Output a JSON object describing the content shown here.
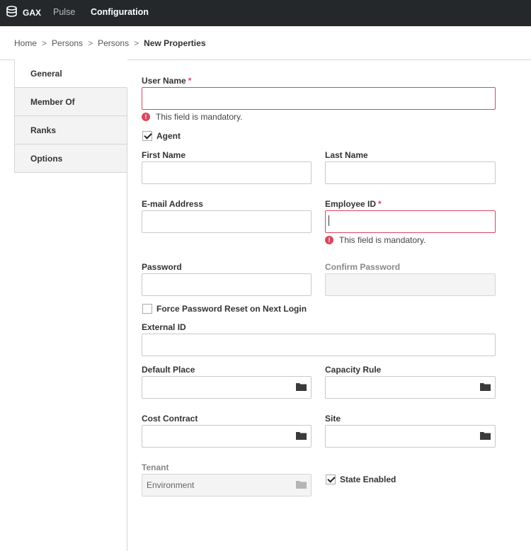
{
  "topbar": {
    "brand": "GAX",
    "nav": {
      "pulse": "Pulse",
      "configuration": "Configuration"
    }
  },
  "breadcrumb": {
    "items": [
      "Home",
      "Persons",
      "Persons"
    ],
    "current": "New Properties",
    "separator": ">"
  },
  "tabs": [
    "General",
    "Member Of",
    "Ranks",
    "Options"
  ],
  "form": {
    "required_mark": "*",
    "mandatory_message": "This field is mandatory.",
    "user_name": {
      "label": "User Name",
      "value": ""
    },
    "agent": {
      "label": "Agent",
      "checked": true
    },
    "first_name": {
      "label": "First Name",
      "value": ""
    },
    "last_name": {
      "label": "Last Name",
      "value": ""
    },
    "email": {
      "label": "E-mail Address",
      "value": ""
    },
    "employee_id": {
      "label": "Employee ID",
      "value": ""
    },
    "password": {
      "label": "Password",
      "value": ""
    },
    "confirm_password": {
      "label": "Confirm Password",
      "value": ""
    },
    "force_reset": {
      "label": "Force Password Reset on Next Login",
      "checked": false
    },
    "external_id": {
      "label": "External ID",
      "value": ""
    },
    "default_place": {
      "label": "Default Place",
      "value": ""
    },
    "capacity_rule": {
      "label": "Capacity Rule",
      "value": ""
    },
    "cost_contract": {
      "label": "Cost Contract",
      "value": ""
    },
    "site": {
      "label": "Site",
      "value": ""
    },
    "tenant": {
      "label": "Tenant",
      "value": "Environment"
    },
    "state_enabled": {
      "label": "State Enabled",
      "checked": true
    }
  },
  "colors": {
    "topbar": "#25282b",
    "error": "#d9485e",
    "border": "#c9c9c9"
  }
}
